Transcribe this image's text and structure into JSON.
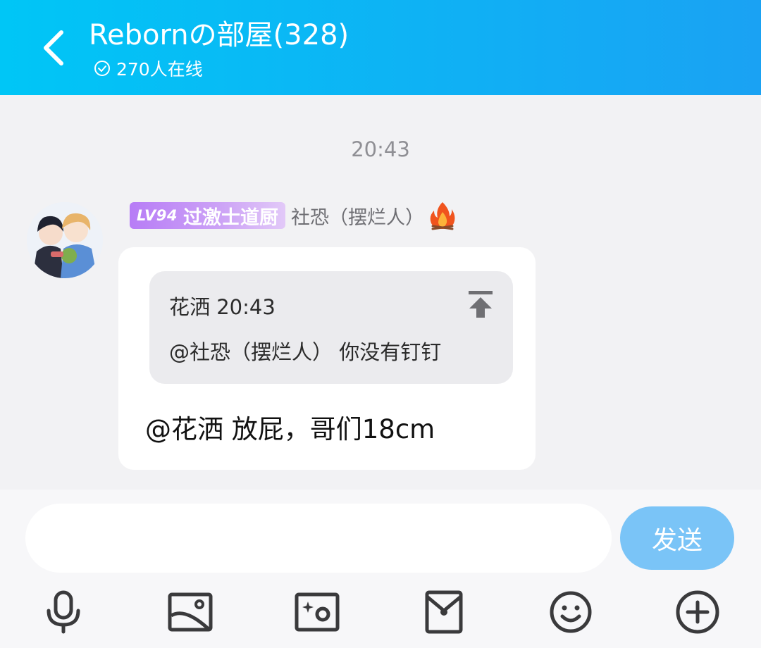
{
  "header": {
    "title": "Rebornの部屋(328)",
    "online_text": "270人在线",
    "background_color": "#1aa2f3"
  },
  "chat": {
    "time_separator": "20:43",
    "message": {
      "level_badge": {
        "level": "LV94",
        "title": "过激士道厨"
      },
      "sender_name": "社恐（摆烂人）",
      "sender_icon": "fire-icon",
      "quote": {
        "header": "花洒 20:43",
        "text": "@社恐（摆烂人） 你没有钉钉"
      },
      "text": "@花洒 放屁，哥们18cm"
    }
  },
  "input_bar": {
    "placeholder": "",
    "send_label": "发送",
    "send_color": "#7ac4f7"
  },
  "toolbar": {
    "icons": [
      "microphone-icon",
      "image-icon",
      "camera-icon",
      "red-packet-icon",
      "emoji-icon",
      "plus-icon"
    ]
  }
}
